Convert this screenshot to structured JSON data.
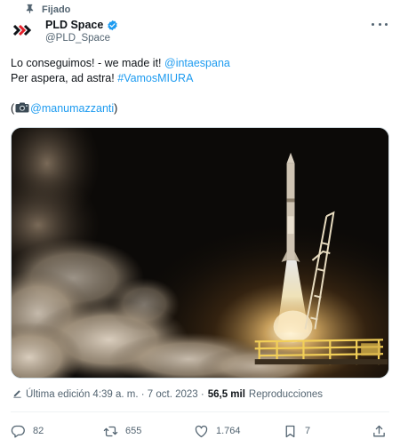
{
  "pinned": {
    "label": "Fijado"
  },
  "author": {
    "name": "PLD Space",
    "handle": "@PLD_Space"
  },
  "tweet": {
    "line1_prefix": "Lo conseguimos! - we made it! ",
    "line1_mention": "@intaespana",
    "line2_prefix": "Per aspera, ad astra! ",
    "line2_hashtag": "#VamosMIURA",
    "credit_open": "(",
    "credit_mention": "@manumazzanti",
    "credit_close": ")"
  },
  "meta": {
    "edited_label": "Última edición 4:39 a. m. · 7 oct. 2023 · ",
    "views_count": "56,5 mil",
    "views_label": " Reproducciones"
  },
  "actions": {
    "replies": "82",
    "reposts": "655",
    "likes": "1.764",
    "bookmarks": "7"
  },
  "icons": [
    "pin-icon",
    "pld-logo-icon",
    "verified-icon",
    "more-icon",
    "camera-icon",
    "edit-icon",
    "reply-icon",
    "repost-icon",
    "like-icon",
    "bookmark-icon",
    "share-icon"
  ],
  "colors": {
    "link": "#1d9bf0",
    "verified": "#1d9bf0",
    "secondary_text": "#536471",
    "brand_red": "#e4202a"
  }
}
